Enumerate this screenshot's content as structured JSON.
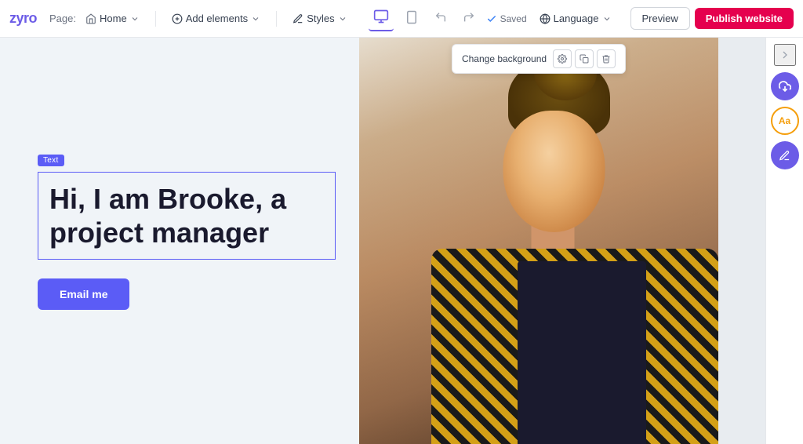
{
  "topbar": {
    "logo": "zyro",
    "page_label": "Page:",
    "home_label": "Home",
    "add_elements_label": "Add elements",
    "styles_label": "Styles",
    "saved_label": "Saved",
    "language_label": "Language",
    "preview_label": "Preview",
    "publish_label": "Publish website"
  },
  "change_bg": {
    "label": "Change background"
  },
  "content": {
    "text_badge": "Text",
    "heading": "Hi, I am Brooke, a project manager",
    "cta_label": "Email me"
  },
  "sidebar": {
    "arrow_label": ">",
    "download_icon": "↓",
    "font_icon": "Aa",
    "edit_icon": "✏"
  }
}
